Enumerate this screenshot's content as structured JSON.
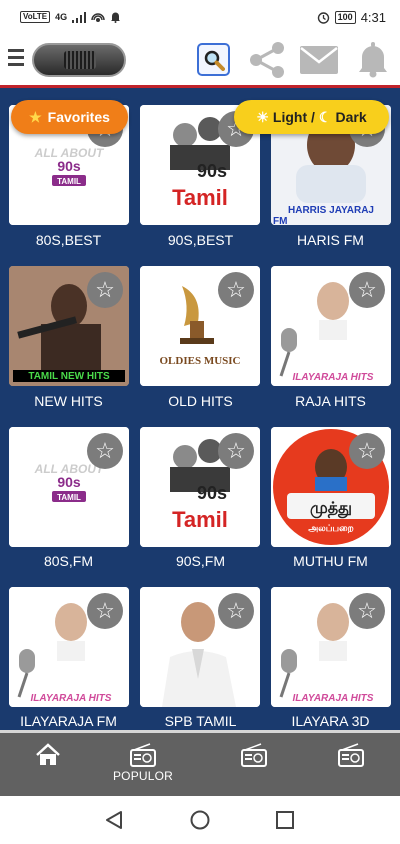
{
  "status": {
    "volte": "VoLTE",
    "network": "4G",
    "battery": "100",
    "time": "4:31"
  },
  "toolbar": {
    "menu_icon": "hamburger-menu-icon",
    "logo_icon": "radio-logo-icon",
    "search_icon": "magnifier-icon",
    "share_icon": "share-icon",
    "mail_icon": "mail-icon",
    "bell_icon": "bell-icon",
    "accent_color": "#c0232b"
  },
  "pills": {
    "favorites_label": "Favorites",
    "theme_light": "Light /",
    "theme_dark": "Dark"
  },
  "stations": [
    {
      "name": "80S,BEST",
      "art_lines": [
        "ALL ABOUT",
        "90s",
        "TAMIL"
      ]
    },
    {
      "name": "90S,BEST",
      "art_lines": [
        "90s",
        "Tamil"
      ]
    },
    {
      "name": "HARIS FM",
      "art_lines": [
        "HARRIS JAYARAJ",
        "FM"
      ]
    },
    {
      "name": "NEW HITS",
      "art_lines": [
        "TAMIL NEW HITS"
      ]
    },
    {
      "name": "OLD HITS",
      "art_lines": [
        "OLDIES MUSIC"
      ]
    },
    {
      "name": "RAJA HITS",
      "art_lines": [
        "ILAYARAJA HITS"
      ]
    },
    {
      "name": "80S,FM",
      "art_lines": [
        "ALL ABOUT",
        "90s",
        "TAMIL"
      ]
    },
    {
      "name": "90S,FM",
      "art_lines": [
        "90s",
        "Tamil"
      ]
    },
    {
      "name": "MUTHU FM",
      "art_lines": [
        "முத்து",
        "அலப்பறை"
      ]
    },
    {
      "name": "ILAYARAJA FM",
      "art_lines": [
        "ILAYARAJA HITS"
      ]
    },
    {
      "name": "SPB TAMIL",
      "art_lines": []
    },
    {
      "name": "ILAYARA 3D",
      "art_lines": [
        "ILAYARAJA HITS"
      ]
    }
  ],
  "bottom_nav": {
    "home_icon": "home-icon",
    "popular_label": "POPULOR",
    "popular_icon": "radio-icon",
    "tab3_icon": "radio-icon",
    "tab4_icon": "radio-icon"
  },
  "system_nav": {
    "back_icon": "back-triangle-icon",
    "home_icon": "home-circle-icon",
    "recents_icon": "recents-square-icon"
  },
  "colors": {
    "background": "#1a3a6e",
    "favorites_pill": "#f07e18",
    "theme_pill": "#f8cf1c",
    "bottom_nav": "#616161"
  }
}
